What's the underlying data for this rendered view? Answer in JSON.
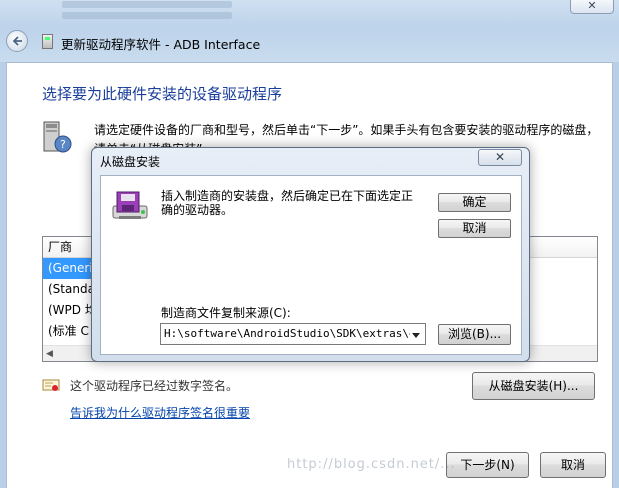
{
  "window": {
    "title": "更新驱动程序软件 - ADB Interface",
    "close_label": "✕"
  },
  "main": {
    "heading": "选择要为此硬件安装的设备驱动程序",
    "description": "请选定硬件设备的厂商和型号，然后单击“下一步”。如果手头有包含要安装的驱动程序的磁盘，请单击“从磁盘安装”。",
    "list": {
      "header": "厂商",
      "items": [
        "(Generi",
        "(Standa",
        "(WPD 均",
        "(标准 C"
      ]
    },
    "signed_text": "这个驱动程序已经过数字签名。",
    "signature_link": "告诉我为什么驱动程序签名很重要",
    "have_disk_label": "从磁盘安装(H)...",
    "next_label": "下一步(N)",
    "cancel_label": "取消"
  },
  "dialog": {
    "title": "从磁盘安装",
    "close_label": "✕",
    "message": "插入制造商的安装盘，然后确定已在下面选定正确的驱动器。",
    "ok_label": "确定",
    "cancel_label": "取消",
    "source_label": "制造商文件复制来源(C):",
    "source_value": "H:\\software\\AndroidStudio\\SDK\\extras\\goo",
    "browse_label": "浏览(B)..."
  },
  "watermark": "http://blog.csdn.net/..."
}
